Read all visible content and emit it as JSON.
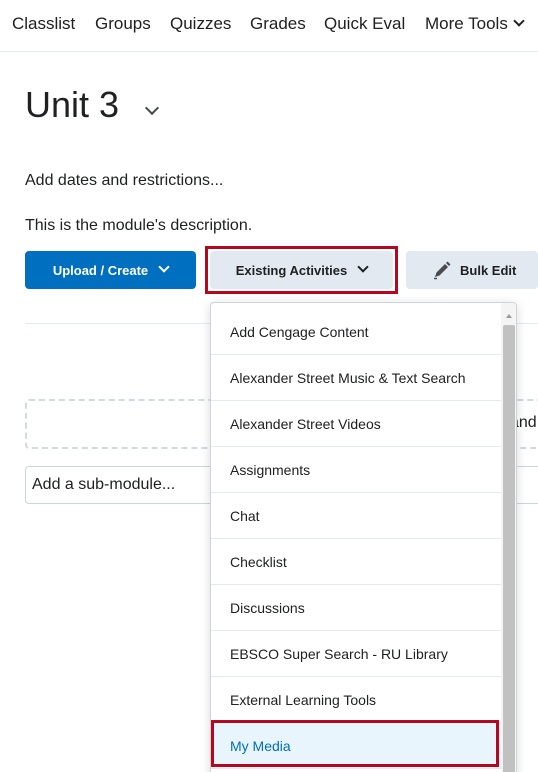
{
  "nav": {
    "items": [
      "Classlist",
      "Groups",
      "Quizzes",
      "Grades",
      "Quick Eval"
    ],
    "more": "More Tools"
  },
  "module": {
    "title": "Unit 3",
    "dates_link": "Add dates and restrictions...",
    "description": "This is the module's description."
  },
  "toolbar": {
    "upload_create": "Upload / Create",
    "existing_activities": "Existing Activities",
    "bulk_edit": "Bulk Edit"
  },
  "dropzone_text": "and",
  "submodule_placeholder": "Add a sub-module...",
  "menu": {
    "items": [
      "Add Cengage Content",
      "Alexander Street Music & Text Search",
      "Alexander Street Videos",
      "Assignments",
      "Chat",
      "Checklist",
      "Discussions",
      "EBSCO Super Search - RU Library",
      "External Learning Tools",
      "My Media"
    ],
    "selected": "My Media"
  },
  "colors": {
    "primary": "#006fbf",
    "highlight": "#b5081e",
    "button_secondary": "#e3e9f1",
    "selected_bg": "#e8f5fd"
  }
}
